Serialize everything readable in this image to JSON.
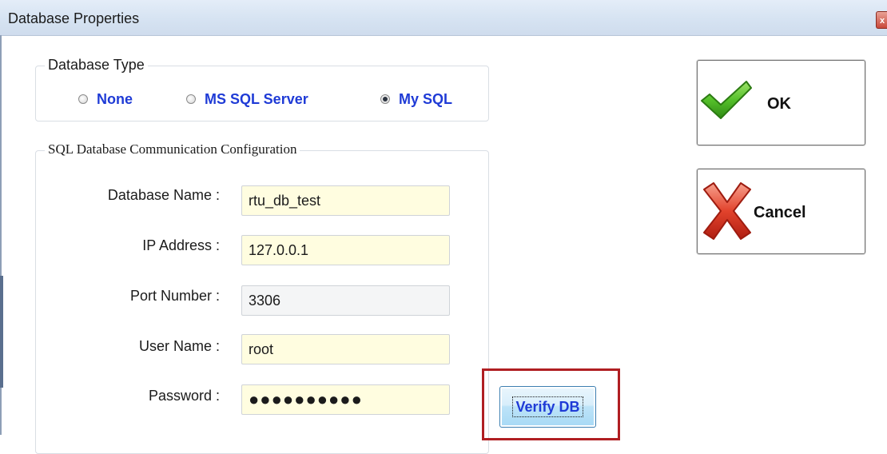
{
  "window": {
    "title": "Database Properties",
    "close_glyph": "x"
  },
  "database_type": {
    "legend": "Database Type",
    "options": [
      {
        "label": "None",
        "checked": false
      },
      {
        "label": "MS SQL Server",
        "checked": false
      },
      {
        "label": "My SQL",
        "checked": true
      }
    ]
  },
  "sql_config": {
    "legend": "SQL Database Communication Configuration",
    "fields": [
      {
        "label": "Database Name :",
        "value": "rtu_db_test"
      },
      {
        "label": "IP Address :",
        "value": "127.0.0.1"
      },
      {
        "label": "Port Number :",
        "value": "3306"
      },
      {
        "label": "User Name :",
        "value": "root"
      },
      {
        "label": "Password :",
        "value": "●●●●●●●●●●"
      }
    ],
    "verify_label": "Verify DB"
  },
  "buttons": {
    "ok_label": "OK",
    "ok_icon": "green-checkmark-icon",
    "cancel_label": "Cancel",
    "cancel_icon": "red-x-icon"
  },
  "colors": {
    "radio_label": "#1f3bd6",
    "input_bg": "#fffde0",
    "highlight": "#b01e22"
  }
}
